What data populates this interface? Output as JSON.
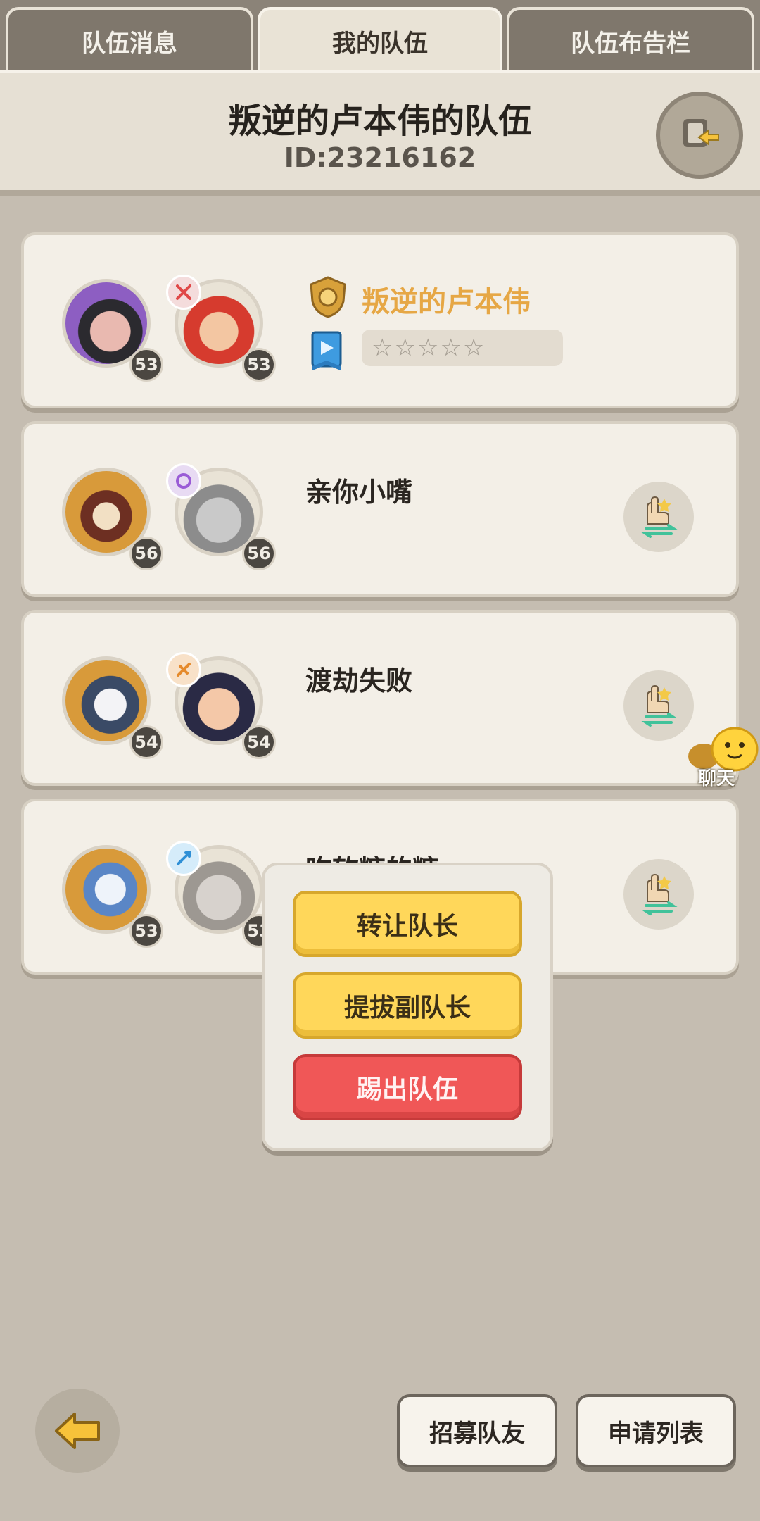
{
  "tabs": [
    {
      "label": "队伍消息"
    },
    {
      "label": "我的队伍"
    },
    {
      "label": "队伍布告栏"
    }
  ],
  "team": {
    "name": "叛逆的卢本伟的队伍",
    "id": "ID:23216162"
  },
  "members": [
    {
      "name": "叛逆的卢本伟",
      "pet_level": "53",
      "hero_level": "53",
      "rating": "☆☆☆☆☆",
      "role": "leader"
    },
    {
      "name": "亲你小嘴",
      "pet_level": "56",
      "hero_level": "56"
    },
    {
      "name": "渡劫失败",
      "pet_level": "54",
      "hero_level": "54"
    },
    {
      "name": "吃软糖的糖",
      "pet_level": "53",
      "hero_level": "53"
    }
  ],
  "popup": {
    "transfer_label": "转让队长",
    "promote_label": "提拔副队长",
    "kick_label": "踢出队伍"
  },
  "chat": {
    "label": "聊天"
  },
  "bottom": {
    "recruit_label": "招募队友",
    "apply_list_label": "申请列表"
  },
  "colors": {
    "leader_name": "#e6a745",
    "yellow_button": "#ffd75a",
    "red_button": "#f05757",
    "background": "#c5bdb1"
  }
}
